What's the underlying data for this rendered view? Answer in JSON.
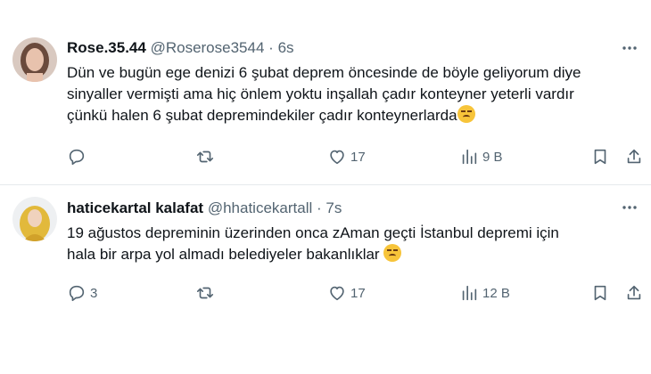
{
  "tweets": [
    {
      "display_name": "Rose.35.44",
      "handle": "@Roserose3544",
      "separator": "·",
      "time": "6s",
      "text": "Dün ve bugün ege denizi 6 şubat deprem öncesinde de böyle geliyorum diye\nsinyaller vermişti ama hiç önlem yoktu inşallah çadır konteyner yeterli vardır\nçünkü halen 6 şubat depremindekiler çadır konteynerlarda",
      "emoji": "persevering-face",
      "stats": {
        "replies": "",
        "retweets": "",
        "likes": "17",
        "views": "9 B"
      }
    },
    {
      "display_name": "haticekartal kalafat",
      "handle": "@hhaticekartall",
      "separator": "·",
      "time": "7s",
      "text": "19 ağustos  depreminin üzerinden onca zAman geçti İstanbul depremi için\nhala bir arpa yol almadı belediyeler bakanlıklar",
      "emoji": "pensive-face",
      "stats": {
        "replies": "3",
        "retweets": "",
        "likes": "17",
        "views": "12 B"
      }
    }
  ],
  "icons": {
    "reply": "reply-icon",
    "retweet": "retweet-icon",
    "like": "heart-icon",
    "views": "views-icon",
    "bookmark": "bookmark-icon",
    "share": "share-icon",
    "more": "more-icon"
  },
  "colors": {
    "text": "#0f1419",
    "muted": "#536471",
    "divider": "#e5e9ec"
  }
}
